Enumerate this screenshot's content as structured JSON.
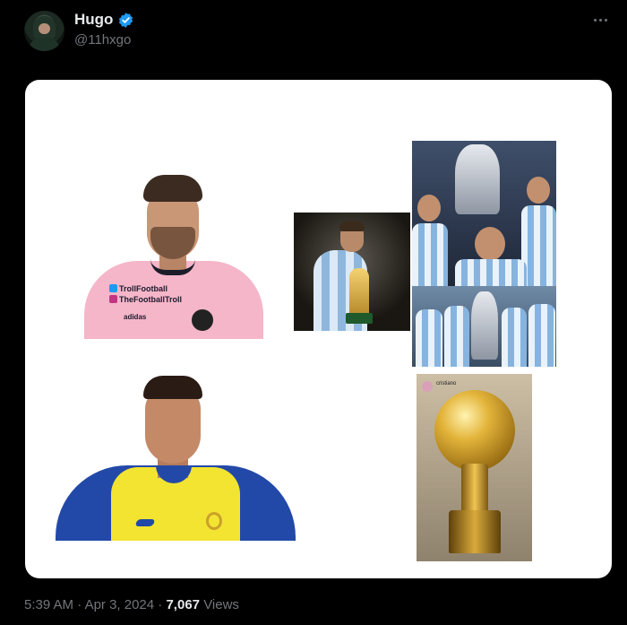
{
  "author": {
    "display_name": "Hugo",
    "handle": "@11hxgo",
    "verified": true
  },
  "icons": {
    "verified": "verified-badge-icon",
    "more": "more-options-icon"
  },
  "media": {
    "messi_miami": {
      "label_twitter": "TrollFootball",
      "label_instagram": "TheFootballTroll",
      "brand": "adidas"
    },
    "golden_trophy": {
      "ig_user": "cristiano"
    }
  },
  "meta": {
    "time": "5:39 AM",
    "separator": "·",
    "date": "Apr 3, 2024",
    "views_count": "7,067",
    "views_label": "Views"
  },
  "colors": {
    "background": "#000000",
    "verified": "#1d9bf0",
    "muted": "#71767b"
  }
}
